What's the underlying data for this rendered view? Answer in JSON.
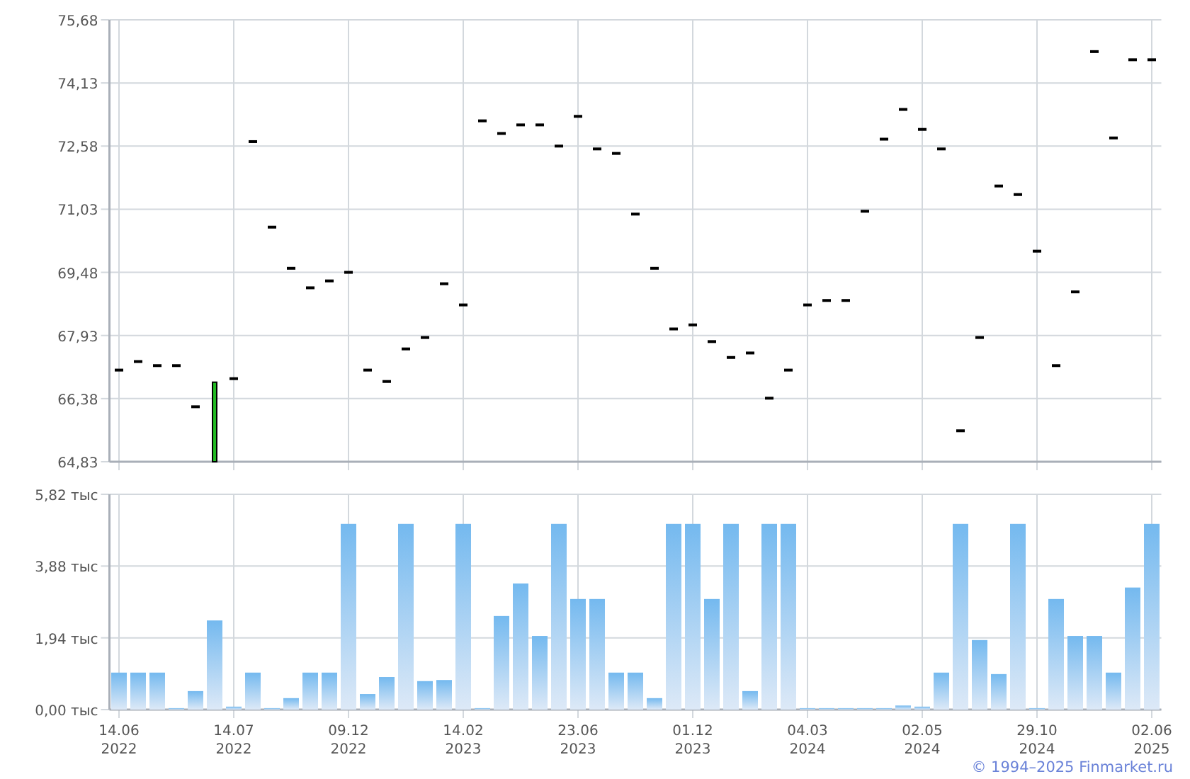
{
  "price_chart": {
    "chart_data": {
      "type": "scatter",
      "categories": [
        null,
        null,
        null,
        null,
        null,
        null,
        null,
        null,
        null,
        null,
        null,
        null,
        null,
        null,
        null,
        null,
        null,
        null,
        null,
        null,
        null,
        null,
        null,
        null,
        null,
        null,
        null,
        null,
        null,
        null,
        null,
        null,
        null,
        null,
        null,
        null,
        null,
        null,
        null,
        null,
        null,
        null,
        null,
        null,
        null,
        null,
        null,
        null,
        null,
        null,
        null,
        null,
        null,
        null,
        null
      ],
      "series": [
        {
          "type": "scatter",
          "color": "#000000",
          "values": [
            67.08,
            67.29,
            67.19,
            67.19,
            66.18,
            null,
            66.87,
            72.69,
            70.59,
            69.58,
            69.1,
            69.27,
            69.48,
            67.08,
            66.8,
            67.6,
            67.88,
            69.2,
            68.68,
            73.2,
            72.89,
            73.1,
            73.1,
            72.58,
            73.31,
            72.51,
            72.4,
            70.91,
            69.58,
            68.09,
            68.19,
            67.78,
            67.39,
            67.5,
            66.39,
            67.08,
            68.68,
            68.79,
            68.79,
            70.98,
            72.75,
            73.48,
            72.99,
            72.51,
            65.59,
            67.88,
            71.6,
            71.39,
            70.0,
            67.19,
            69.0,
            74.9,
            72.78,
            74.7,
            74.7
          ]
        },
        {
          "type": "bar",
          "color": "#22bb22",
          "values": [
            null,
            null,
            null,
            null,
            null,
            66.8,
            null,
            null,
            null,
            null,
            null,
            null,
            null,
            null,
            null,
            null,
            null,
            null,
            null,
            null,
            null,
            null,
            null,
            null,
            null,
            null,
            null,
            null,
            null,
            null,
            null,
            null,
            null,
            null,
            null,
            null,
            null,
            null,
            null,
            null,
            null,
            null,
            null,
            null,
            null,
            null,
            null,
            null,
            null,
            null,
            null,
            null,
            null,
            null,
            null
          ]
        }
      ],
      "ylim": [
        64.83,
        75.68
      ],
      "grid": true,
      "yticks": [
        {
          "value": 75.68,
          "label": "75,68"
        },
        {
          "value": 74.13,
          "label": "74,13"
        },
        {
          "value": 72.58,
          "label": "72,58"
        },
        {
          "value": 71.03,
          "label": "71,03"
        },
        {
          "value": 69.48,
          "label": "69,48"
        },
        {
          "value": 67.93,
          "label": "67,93"
        },
        {
          "value": 66.38,
          "label": "66,38"
        },
        {
          "value": 64.83,
          "label": "64,83"
        }
      ]
    }
  },
  "volume_chart": {
    "chart_data": {
      "type": "bar",
      "categories": [
        "14.06\n2022",
        null,
        null,
        null,
        null,
        null,
        "14.07\n2022",
        null,
        null,
        null,
        null,
        null,
        "09.12\n2022",
        null,
        null,
        null,
        null,
        null,
        "14.02\n2023",
        null,
        null,
        null,
        null,
        null,
        "23.06\n2023",
        null,
        null,
        null,
        null,
        null,
        "01.12\n2023",
        null,
        null,
        null,
        null,
        null,
        "04.03\n2024",
        null,
        null,
        null,
        null,
        null,
        "02.05\n2024",
        null,
        null,
        null,
        null,
        null,
        "29.10\n2024",
        null,
        null,
        null,
        null,
        null,
        "02.06\n2025"
      ],
      "series": [
        {
          "color": "#74b9ef",
          "values": [
            1.0,
            1.0,
            1.0,
            0.04,
            0.5,
            2.41,
            0.08,
            1.0,
            0.04,
            0.31,
            1.0,
            1.0,
            5.02,
            0.42,
            0.88,
            5.02,
            0.77,
            0.8,
            5.02,
            0.04,
            2.53,
            3.41,
            1.99,
            5.02,
            2.99,
            2.99,
            1.0,
            1.0,
            0.31,
            5.02,
            5.02,
            2.99,
            5.02,
            0.5,
            5.02,
            5.02,
            0.04,
            0.04,
            0.04,
            0.04,
            0.04,
            0.11,
            0.08,
            1.0,
            5.02,
            1.88,
            0.96,
            5.02,
            0.04,
            2.99,
            1.99,
            1.99,
            1.0,
            3.3,
            5.02
          ]
        }
      ],
      "ylim": [
        0,
        5.82
      ],
      "grid": true,
      "yticks": [
        {
          "value": 5.82,
          "label": "5,82 тыс"
        },
        {
          "value": 3.88,
          "label": "3,88 тыс"
        },
        {
          "value": 1.94,
          "label": "1,94 тыс"
        },
        {
          "value": 0,
          "label": "0,00 тыс"
        }
      ]
    }
  },
  "copyright": "© 1994–2025 Finmarket.ru"
}
